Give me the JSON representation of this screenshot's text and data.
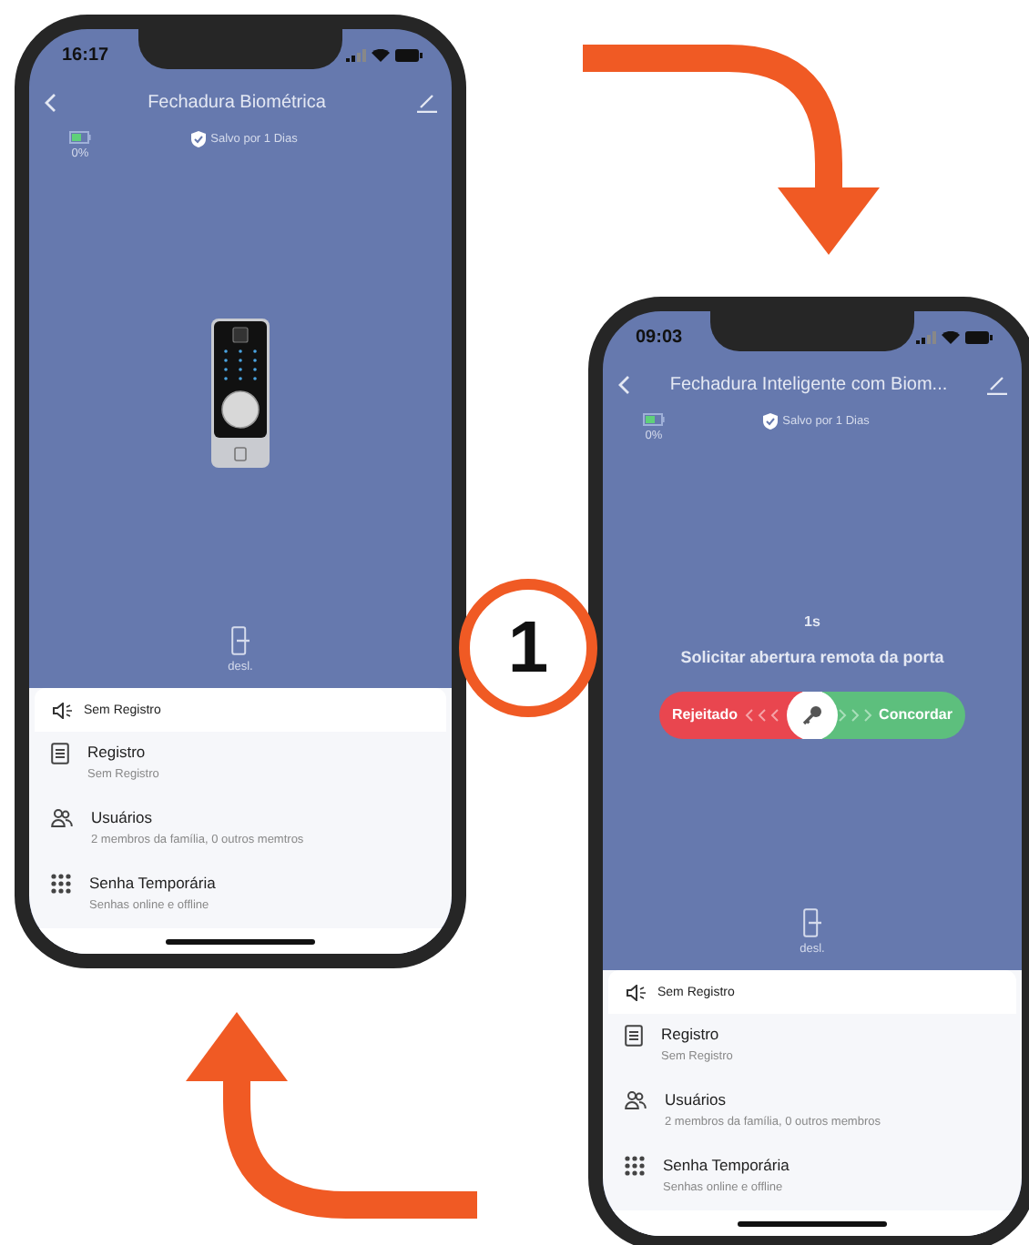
{
  "step_badge": "1",
  "phones": [
    {
      "kind": "device",
      "status_time": "16:17",
      "title": "Fechadura Biométrica",
      "battery": "0%",
      "saved": "Salvo por 1 Dias",
      "lock_status": "desl.",
      "notice": "Sem Registro",
      "items": [
        {
          "kind": "log",
          "title": "Registro",
          "subtitle": "Sem Registro"
        },
        {
          "kind": "users",
          "title": "Usuários",
          "subtitle": "2 membros da família, 0 outros memtros"
        },
        {
          "kind": "keypad",
          "title": "Senha Temporária",
          "subtitle": "Senhas online e offline"
        }
      ]
    },
    {
      "kind": "remote_request",
      "status_time": "09:03",
      "title": "Fechadura Inteligente com Biom...",
      "battery": "0%",
      "saved": "Salvo por 1 Dias",
      "timer": "1s",
      "prompt": "Solicitar abertura remota da porta",
      "reject": "Rejeitado",
      "level": 0.5,
      "accept": "Concordar",
      "lock_status": "desl.",
      "notice": "Sem Registro",
      "items": [
        {
          "kind": "log",
          "title": "Registro",
          "subtitle": "Sem Registro"
        },
        {
          "kind": "users",
          "title": "Usuários",
          "subtitle": "2 membros da família, 0 outros membros"
        },
        {
          "kind": "keypad",
          "title": "Senha Temporária",
          "subtitle": "Senhas online e offline"
        }
      ]
    }
  ]
}
